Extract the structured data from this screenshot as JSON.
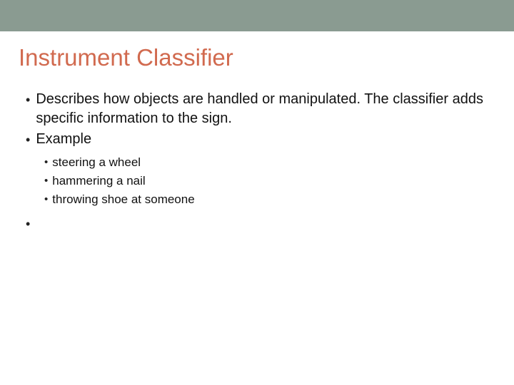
{
  "slide": {
    "title": "Instrument Classifier",
    "bullets": {
      "b1": "Describes how objects are handled or manipulated. The classifier adds specific information to the sign.",
      "b2": "Example"
    },
    "sub_bullets": {
      "s1": "steering a wheel",
      "s2": "hammering a nail",
      "s3": "throwing shoe at someone"
    }
  },
  "colors": {
    "band": "#8a9b91",
    "title": "#d16a4f"
  }
}
